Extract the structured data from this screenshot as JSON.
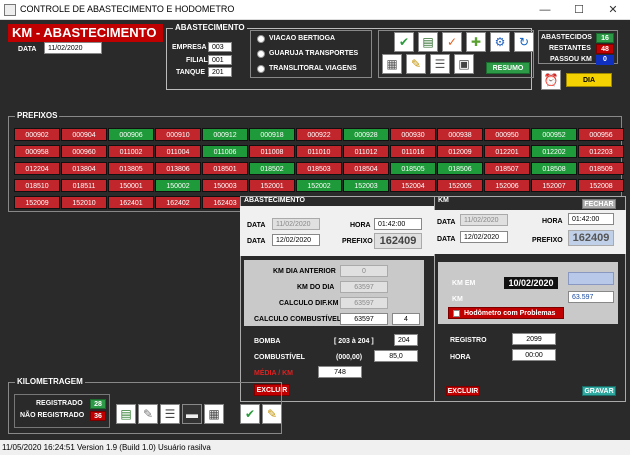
{
  "window": {
    "title": "CONTROLE DE ABASTECIMENTO E HODOMETRO",
    "minimize": "—",
    "maximize": "☐",
    "close": "✕"
  },
  "header": {
    "title": "KM - ABASTECIMENTO",
    "data_label": "DATA",
    "data_value": "11/02/2020"
  },
  "abastecimento_box": {
    "title": "ABASTECIMENTO",
    "empresa_label": "EMPRESA",
    "empresa_value": "003",
    "filial_label": "FILIAL",
    "filial_value": "001",
    "tanque_label": "TANQUE",
    "tanque_value": "201",
    "radios": [
      "VIACAO BERTIOGA",
      "GUARUJA TRANSPORTES",
      "TRANSLITORAL VIAGENS"
    ],
    "resumo_label": "RESUMO"
  },
  "counters": {
    "abastecidos_label": "ABASTECIDOS",
    "abastecidos_value": "16",
    "restantes_label": "RESTANTES",
    "restantes_value": "48",
    "passou_km_label": "PASSOU KM",
    "passou_km_value": "0",
    "dia_label": "DIA"
  },
  "prefixos": {
    "title": "PREFIXOS",
    "rows": [
      [
        [
          "000902",
          "red"
        ],
        [
          "000904",
          "red"
        ],
        [
          "000906",
          "green"
        ],
        [
          "000910",
          "red"
        ],
        [
          "000912",
          "green"
        ],
        [
          "000918",
          "green"
        ],
        [
          "000922",
          "red"
        ],
        [
          "000928",
          "green"
        ],
        [
          "000930",
          "red"
        ],
        [
          "000938",
          "red"
        ],
        [
          "000950",
          "red"
        ],
        [
          "000952",
          "green"
        ],
        [
          "000956",
          "red"
        ]
      ],
      [
        [
          "000958",
          "red"
        ],
        [
          "000960",
          "red"
        ],
        [
          "011002",
          "red"
        ],
        [
          "011004",
          "red"
        ],
        [
          "011006",
          "green"
        ],
        [
          "011008",
          "red"
        ],
        [
          "011010",
          "red"
        ],
        [
          "011012",
          "red"
        ],
        [
          "011016",
          "red"
        ],
        [
          "012009",
          "red"
        ],
        [
          "012201",
          "red"
        ],
        [
          "012202",
          "green"
        ],
        [
          "012203",
          "red"
        ]
      ],
      [
        [
          "012204",
          "red"
        ],
        [
          "013804",
          "red"
        ],
        [
          "013805",
          "red"
        ],
        [
          "013806",
          "red"
        ],
        [
          "018501",
          "red"
        ],
        [
          "018502",
          "green"
        ],
        [
          "018503",
          "red"
        ],
        [
          "018504",
          "red"
        ],
        [
          "018505",
          "green"
        ],
        [
          "018506",
          "green"
        ],
        [
          "018507",
          "red"
        ],
        [
          "018508",
          "green"
        ],
        [
          "018509",
          "red"
        ]
      ],
      [
        [
          "018510",
          "red"
        ],
        [
          "018511",
          "red"
        ],
        [
          "150001",
          "red"
        ],
        [
          "150002",
          "green"
        ],
        [
          "150003",
          "red"
        ],
        [
          "152001",
          "red"
        ],
        [
          "152002",
          "green"
        ],
        [
          "152003",
          "green"
        ],
        [
          "152004",
          "red"
        ],
        [
          "152005",
          "red"
        ],
        [
          "152006",
          "red"
        ],
        [
          "152007",
          "red"
        ],
        [
          "152008",
          "red"
        ]
      ],
      [
        [
          "152009",
          "red"
        ],
        [
          "152010",
          "red"
        ],
        [
          "162401",
          "red"
        ],
        [
          "162402",
          "red"
        ],
        [
          "162403",
          "red"
        ]
      ]
    ]
  },
  "abast_panel": {
    "title": "ABASTECIMENTO",
    "data_label": "DATA",
    "data_prev": "11/02/2020",
    "hora_label": "HORA",
    "hora_value": "01:42:00",
    "data_value": "12/02/2020",
    "prefixo_label": "PREFIXO",
    "prefixo_value": "162409",
    "km_dia_anterior_label": "KM DIA ANTERIOR",
    "km_dia_anterior_value": "0",
    "km_do_dia_label": "KM DO DIA",
    "km_do_dia_value": "63597",
    "calculo_dif_label": "CALCULO DIF.KM",
    "calculo_dif_value": "63597",
    "calculo_comb_label": "CALCULO COMBUSTÍVEL",
    "calculo_comb_value": "63597",
    "calculo_comb_extra": "4",
    "bomba_label": "BOMBA",
    "bomba_range": "[ 203 à 204 ]",
    "bomba_value": "204",
    "combustivel_label": "COMBUSTÍVEL",
    "combustivel_range": "(000,00)",
    "combustivel_value": "85,0",
    "media_label": "MÉDIA / KM",
    "media_value": "748",
    "excluir_label": "EXCLUIR"
  },
  "km_panel": {
    "title": "KM",
    "fechar_label": "FECHAR",
    "data_label": "DATA",
    "data_prev": "11/02/2020",
    "hora_label": "HORA",
    "hora_value": "01:42:00",
    "data_value": "12/02/2020",
    "prefixo_label": "PREFIXO",
    "prefixo_value": "162409",
    "km_em_label": "KM EM",
    "km_em_value": "10/02/2020",
    "km_label": "KM",
    "km_value": "63.597",
    "hodometro_label": "Hodômetro com Problemas",
    "registro_label": "REGISTRO",
    "registro_value": "2099",
    "hora2_label": "HORA",
    "hora2_value": "00:00",
    "excluir_label": "EXCLUIR",
    "gravar_label": "GRAVAR"
  },
  "kilometragem": {
    "title": "KILOMETRAGEM",
    "registrado_label": "REGISTRADO",
    "registrado_value": "28",
    "nao_registrado_label": "NÃO REGISTRADO",
    "nao_registrado_value": "36"
  },
  "statusbar": {
    "text": "11/05/2020 16:24:51   Version 1.9 (Build 1.0)  Usuário rasilva"
  }
}
